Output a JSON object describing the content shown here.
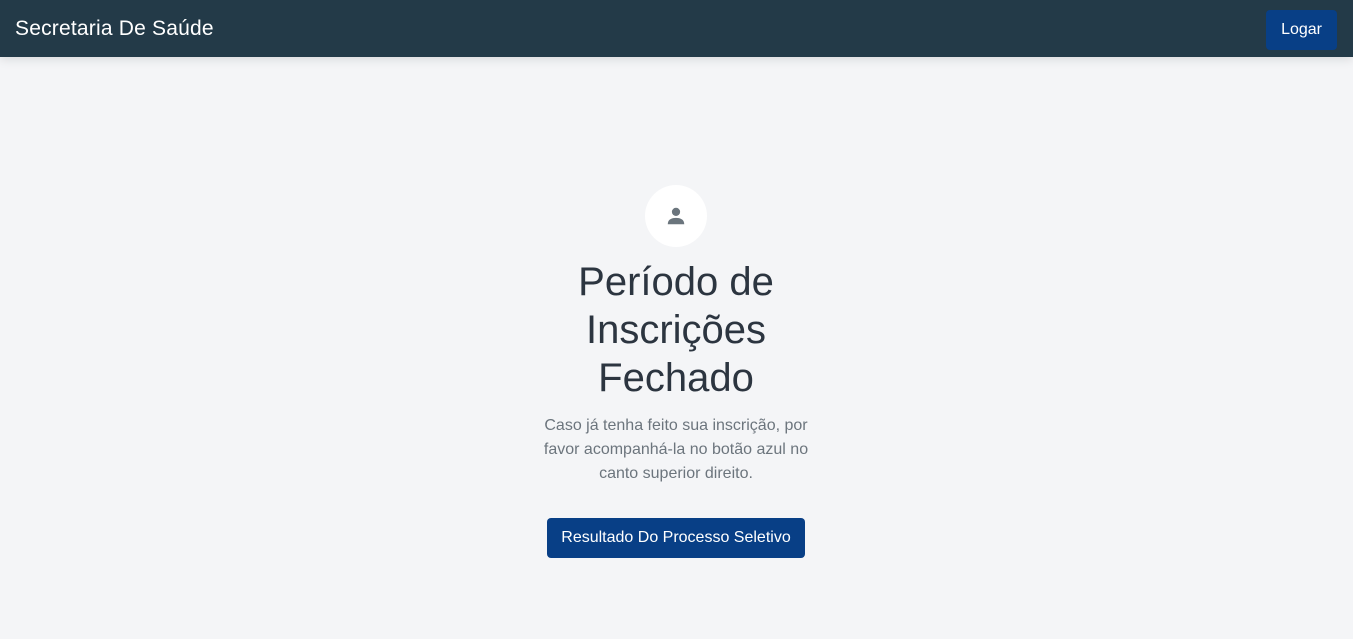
{
  "header": {
    "brand": "Secretaria De Saúde",
    "login_label": "Logar"
  },
  "main": {
    "avatar_icon": "person-icon",
    "title": "Período de Inscrições Fechado",
    "description": "Caso já tenha feito sua inscrição, por favor acompanhá-la no botão azul no canto superior direito.",
    "result_button_label": "Resultado Do Processo Seletivo"
  },
  "colors": {
    "navbar": "#233a48",
    "primary": "#083f86",
    "background": "#f4f5f7",
    "icon": "#6b757d"
  }
}
